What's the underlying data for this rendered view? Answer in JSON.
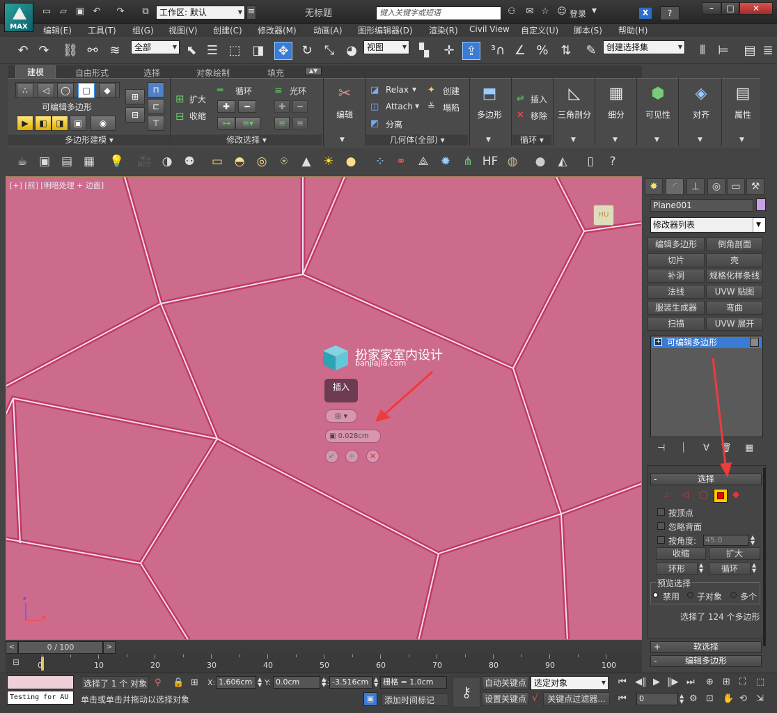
{
  "title_bar": {
    "app_logo_label": "MAX",
    "workspace_label": "工作区: 默认",
    "document_title": "无标题",
    "search_placeholder": "键入关键字或短语",
    "login_label": "登录"
  },
  "menu": [
    "编辑(E)",
    "工具(T)",
    "组(G)",
    "视图(V)",
    "创建(C)",
    "修改器(M)",
    "动画(A)",
    "图形编辑器(D)",
    "渲染(R)",
    "Civil View",
    "自定义(U)",
    "脚本(S)",
    "帮助(H)"
  ],
  "toolbar": {
    "filter_select": "全部",
    "ref_coord_select": "视图",
    "selection_set": "创建选择集"
  },
  "ribbon": {
    "tabs": [
      "建模",
      "自由形式",
      "选择",
      "对象绘制",
      "填充"
    ],
    "active_tab": "建模",
    "panel_poly_modeling": {
      "object_label": "可编辑多边形",
      "footer": "多边形建模"
    },
    "panel_modify_selection": {
      "grow": "扩大",
      "shrink": "收缩",
      "loop": "循环",
      "ring": "光环",
      "footer": "修改选择"
    },
    "panel_edit": {
      "label": "编辑"
    },
    "panel_geometry": {
      "relax": "Relax",
      "create": "创建",
      "attach": "Attach",
      "collapse": "塌陷",
      "detach": "分离",
      "footer": "几何体(全部)"
    },
    "panel_polygons": {
      "label": "多边形"
    },
    "panel_loops": {
      "insert": "插入",
      "remove": "移除",
      "footer": "循环"
    },
    "panel_tris": {
      "label": "三角剖分"
    },
    "panel_subdivision": {
      "label": "细分"
    },
    "panel_visibility": {
      "label": "可见性"
    },
    "panel_align": {
      "label": "对齐"
    },
    "panel_properties": {
      "label": "属性"
    }
  },
  "viewport": {
    "label": "[+] [前] [明暗处理 + 边面]",
    "watermark_title": "扮家家室内设计",
    "watermark_sub": "banjiajia.com",
    "caddy_title": "插入",
    "caddy_value": "0.028cm",
    "axis_z": "z",
    "axis_x": "x"
  },
  "command_panel": {
    "object_name": "Plane001",
    "modifier_list": "修改器列表",
    "modifier_buttons": [
      "编辑多边形",
      "倒角剖面",
      "切片",
      "壳",
      "补洞",
      "规格化样条线",
      "法线",
      "UVW 贴图",
      "服装生成器",
      "弯曲",
      "扫描",
      "UVW 展开"
    ],
    "stack_item": "可编辑多边形",
    "selection_rollout": {
      "header": "选择",
      "by_vertex": "按顶点",
      "ignore_backfacing": "忽略背面",
      "by_angle": "按角度:",
      "angle_value": "45.0",
      "shrink": "收缩",
      "grow": "扩大",
      "ring": "环形",
      "loop": "循环",
      "preview_label": "预览选择",
      "preview_options": [
        "禁用",
        "子对象",
        "多个"
      ],
      "status": "选择了 124 个多边形"
    },
    "soft_selection": "软选择",
    "edit_polygons": "编辑多边形"
  },
  "timeline": {
    "frame_display": "0 / 100",
    "ticks": [
      "0",
      "10",
      "20",
      "30",
      "40",
      "50",
      "60",
      "70",
      "80",
      "90",
      "100"
    ]
  },
  "status_bar": {
    "script_listener": "Testing for AU",
    "selection_status": "选择了 1 个 对象",
    "prompt": "单击或单击并拖动以选择对象",
    "x_label": "X:",
    "x_value": "1.606cm",
    "y_label": "Y:",
    "y_value": "0.0cm",
    "z_label": "Z:",
    "z_value": "-3.516cm",
    "grid": "栅格 = 1.0cm",
    "add_time_tag": "添加时间标记",
    "auto_key": "自动关键点",
    "selected_object": "选定对象",
    "set_key": "设置关键点",
    "key_filters": "关键点过滤器...",
    "current_frame": "0"
  }
}
